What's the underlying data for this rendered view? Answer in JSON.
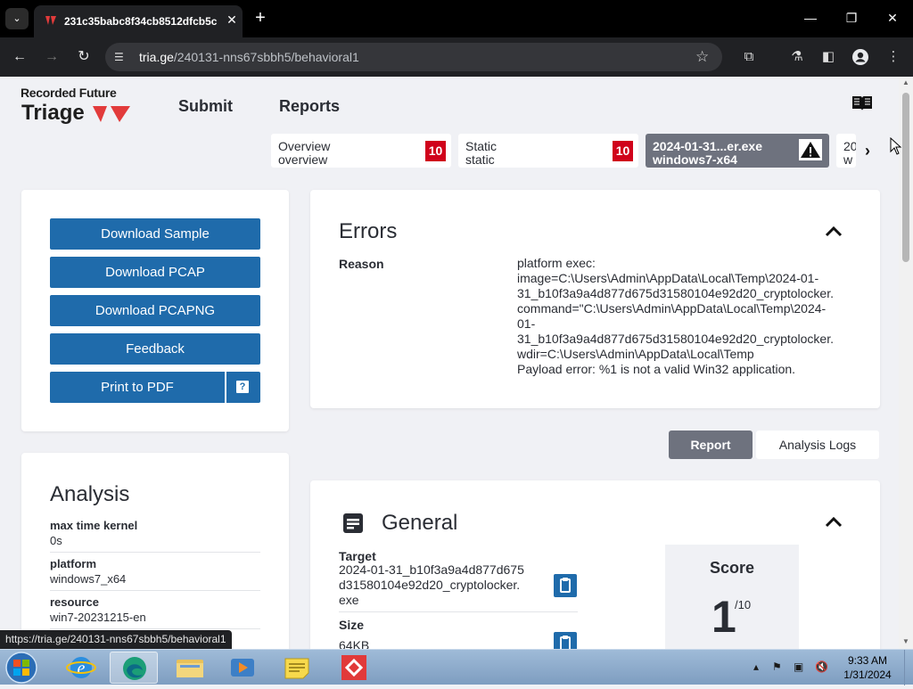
{
  "browser": {
    "tab_title": "231c35babc8f34cb8512dfcb5c",
    "tab_close": "✕",
    "new_tab": "+",
    "url_host": "tria.ge",
    "url_path": "/240131-nns67sbbh5/behavioral1",
    "status_url": "https://tria.ge/240131-nns67sbbh5/behavioral1"
  },
  "header": {
    "logo_top": "Recorded Future",
    "logo_bottom": "Triage",
    "nav": [
      "Submit",
      "Reports"
    ]
  },
  "sample_tabs": [
    {
      "line1": "Overview",
      "line2": "overview",
      "score": "10"
    },
    {
      "line1": "Static",
      "line2": "static",
      "score": "10"
    },
    {
      "line1": "2024-01-31...er.exe",
      "line2": "windows7-x64",
      "alert": "⚠"
    },
    {
      "line1": "20",
      "line2": "w"
    }
  ],
  "actions": {
    "download_sample": "Download Sample",
    "download_pcap": "Download PCAP",
    "download_pcapng": "Download PCAPNG",
    "feedback": "Feedback",
    "print_pdf": "Print to PDF",
    "help": "?"
  },
  "analysis": {
    "title": "Analysis",
    "rows": [
      {
        "key": "max time kernel",
        "value": "0s"
      },
      {
        "key": "platform",
        "value": "windows7_x64"
      },
      {
        "key": "resource",
        "value": "win7-20231215-en"
      }
    ]
  },
  "errors": {
    "title": "Errors",
    "reason_label": "Reason",
    "lines": [
      "platform exec:",
      "image=C:\\Users\\Admin\\AppData\\Local\\Temp\\2024-01-",
      "31_b10f3a9a4d877d675d31580104e92d20_cryptolocker.",
      "command=\"C:\\Users\\Admin\\AppData\\Local\\Temp\\2024-",
      "01-",
      "31_b10f3a9a4d877d675d31580104e92d20_cryptolocker.",
      "wdir=C:\\Users\\Admin\\AppData\\Local\\Temp",
      "Payload error: %1 is not a valid Win32 application."
    ]
  },
  "view_toggle": {
    "report": "Report",
    "logs": "Analysis Logs"
  },
  "general": {
    "title": "General",
    "target_label": "Target",
    "target_lines": [
      "2024-01-31_b10f3a9a4d877d675",
      "d31580104e92d20_cryptolocker.",
      "exe"
    ],
    "size_label": "Size",
    "size_value": "64KB",
    "score_label": "Score",
    "score_value": "1",
    "score_max": "/10"
  },
  "taskbar": {
    "time": "9:33 AM",
    "date": "1/31/2024"
  },
  "colors": {
    "accent_blue": "#1f6bab",
    "score_red": "#d0021b",
    "active_tab": "#6e727e",
    "page_bg": "#f0f1f5"
  }
}
